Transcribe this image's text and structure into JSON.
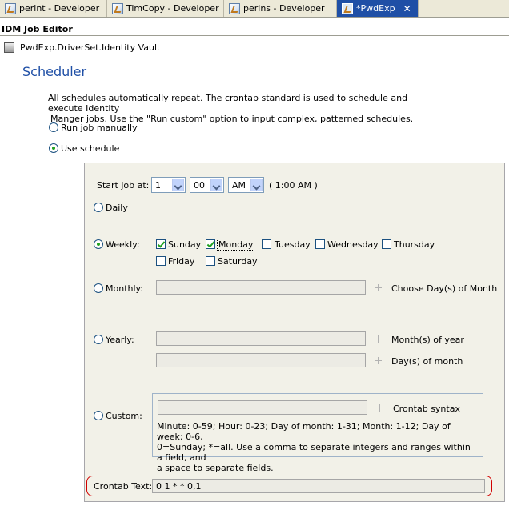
{
  "tabs": [
    {
      "label": "perint - Developer",
      "active": false
    },
    {
      "label": "TimCopy - Developer",
      "active": false
    },
    {
      "label": "perins - Developer",
      "active": false
    },
    {
      "label": "*PwdExp",
      "active": true
    }
  ],
  "editor": {
    "title": "IDM Job Editor",
    "path": "PwdExp.DriverSet.Identity Vault"
  },
  "scheduler": {
    "title": "Scheduler",
    "description_line1": "All schedules automatically repeat. The crontab standard is used to schedule and execute Identity",
    "description_line2": "Manger jobs. Use the \"Run custom\" option to input complex, patterned schedules.",
    "run_manually_label": "Run job manually",
    "use_schedule_label": "Use schedule",
    "selected_mode": "use_schedule"
  },
  "schedule": {
    "start_label": "Start job at:",
    "hour": "1",
    "minute": "00",
    "ampm": "AM",
    "time_preview": "( 1:00 AM )",
    "selected_frequency": "weekly",
    "daily_label": "Daily",
    "weekly_label": "Weekly:",
    "monthly_label": "Monthly:",
    "yearly_label": "Yearly:",
    "custom_label": "Custom:",
    "days": [
      {
        "label": "Sunday",
        "checked": true
      },
      {
        "label": "Monday",
        "checked": true
      },
      {
        "label": "Tuesday",
        "checked": false
      },
      {
        "label": "Wednesday",
        "checked": false
      },
      {
        "label": "Thursday",
        "checked": false
      },
      {
        "label": "Friday",
        "checked": false
      },
      {
        "label": "Saturday",
        "checked": false
      }
    ],
    "monthly_hint": "Choose Day(s) of Month",
    "yearly_months_hint": "Month(s) of year",
    "yearly_days_hint": "Day(s) of month",
    "custom_hint": "Crontab syntax",
    "syntax_line1": "Minute: 0-59; Hour: 0-23; Day of month: 1-31; Month: 1-12; Day of week: 0-6,",
    "syntax_line2": "0=Sunday; *=all. Use a comma to separate integers and ranges within a field, and",
    "syntax_line3": "a space to separate fields.",
    "crontab_label": "Crontab Text:",
    "crontab_value": "0 1 * * 0,1"
  },
  "colors": {
    "accent": "#1f4fa6",
    "highlight_oval": "#d10000",
    "check_green": "#21a121"
  }
}
